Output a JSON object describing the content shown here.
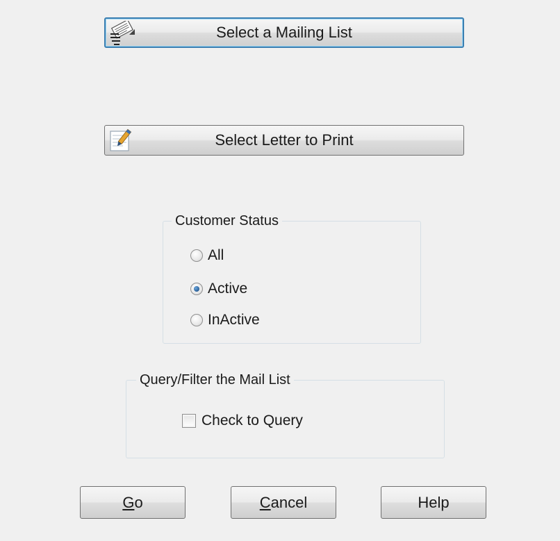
{
  "buttons": {
    "mailing_list": "Select a Mailing List",
    "letter": "Select Letter to Print"
  },
  "customer_status": {
    "legend": "Customer Status",
    "options": [
      {
        "label": "All",
        "checked": false
      },
      {
        "label": "Active",
        "checked": true
      },
      {
        "label": "InActive",
        "checked": false
      }
    ]
  },
  "query_filter": {
    "legend": "Query/Filter the Mail List",
    "checkbox_label": "Check to Query",
    "checked": false
  },
  "bottom": {
    "go": {
      "mnemonic": "G",
      "rest": "o"
    },
    "cancel": {
      "mnemonic": "C",
      "rest": "ancel"
    },
    "help": "Help"
  },
  "icons": {
    "mailing_list": "mailing-list-icon",
    "letter": "letter-edit-icon"
  },
  "colors": {
    "focus_border": "#3c7fb1",
    "radio_selected": "#2a5f96"
  }
}
